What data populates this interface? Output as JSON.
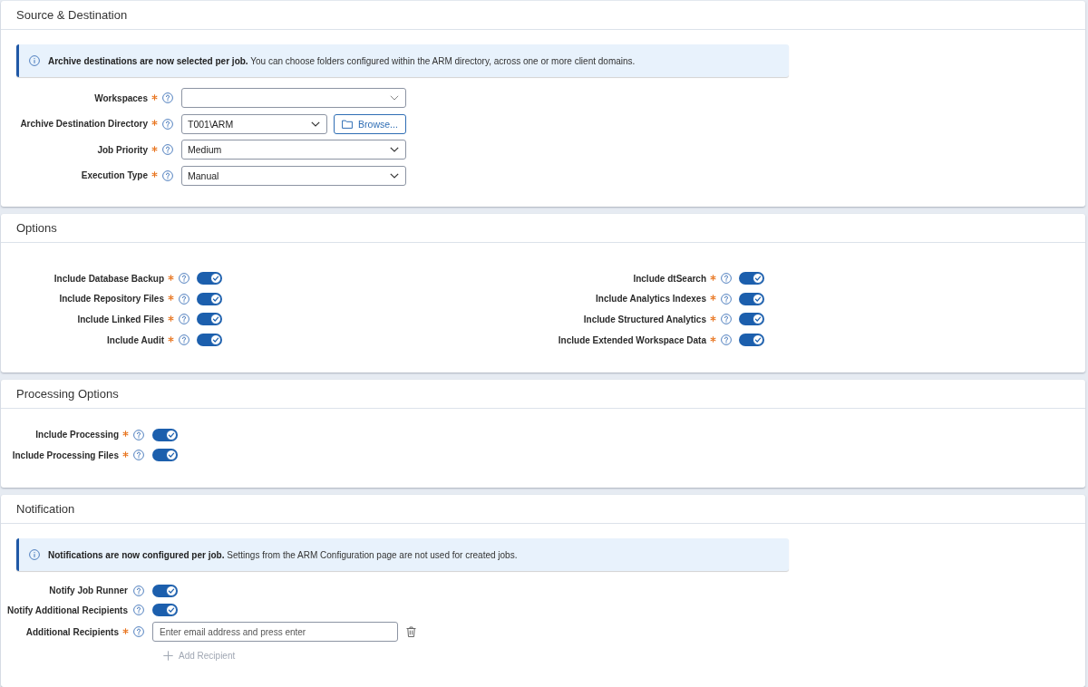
{
  "sections": [
    {
      "title": "Source & Destination",
      "kind": "form",
      "notice": "**Archive destinations are now selected per job.** You can choose folders configured within the ARM directory, across one or more client domains.",
      "fields": [
        {
          "label": "Workspaces",
          "required": true,
          "kind": "select"
        },
        {
          "label": "Archive Destination Directory",
          "required": true,
          "kind": "select",
          "value": "T001\\ARM",
          "button": "Browse..."
        },
        {
          "label": "Job Priority",
          "required": true,
          "kind": "select",
          "value": "Medium"
        },
        {
          "label": "Execution Type",
          "required": true,
          "kind": "select",
          "value": "Manual"
        }
      ]
    },
    {
      "title": "Options",
      "kind": "two-column",
      "columns": [
        {
          "fields": [
            {
              "label": "Include Database Backup",
              "required": true,
              "kind": "toggle",
              "on": true
            },
            {
              "label": "Include Repository Files",
              "required": true,
              "kind": "toggle",
              "on": true
            },
            {
              "label": "Include Linked Files",
              "required": true,
              "kind": "toggle",
              "on": true
            },
            {
              "label": "Include Audit",
              "required": true,
              "kind": "toggle",
              "on": true
            }
          ]
        },
        {
          "fields": [
            {
              "label": "Include dtSearch",
              "required": true,
              "kind": "toggle",
              "on": true
            },
            {
              "label": "Include Analytics Indexes",
              "required": true,
              "kind": "toggle",
              "on": true
            },
            {
              "label": "Include Structured Analytics",
              "required": true,
              "kind": "toggle",
              "on": true
            },
            {
              "label": "Include Extended Workspace Data",
              "required": true,
              "kind": "toggle",
              "on": true
            }
          ]
        }
      ]
    },
    {
      "title": "Processing Options",
      "kind": "form",
      "fields": [
        {
          "label": "Include Processing",
          "required": true,
          "kind": "toggle",
          "on": true
        },
        {
          "label": "Include Processing Files",
          "required": true,
          "kind": "toggle",
          "on": true
        }
      ]
    },
    {
      "title": "Notification",
      "kind": "form",
      "notice": "**Notifications are now configured per job.** Settings from the ARM Configuration page are not used for created jobs.",
      "fields": [
        {
          "label": "Notify Job Runner",
          "required": false,
          "kind": "toggle",
          "on": true
        },
        {
          "label": "Notify Additional Recipients",
          "required": false,
          "kind": "toggle",
          "on": true
        },
        {
          "label": "Additional Recipients",
          "required": true,
          "kind": "text",
          "placeholder": "Enter email address and press enter"
        }
      ],
      "add_button": {
        "label": "Add Recipient",
        "disabled": true
      }
    }
  ]
}
